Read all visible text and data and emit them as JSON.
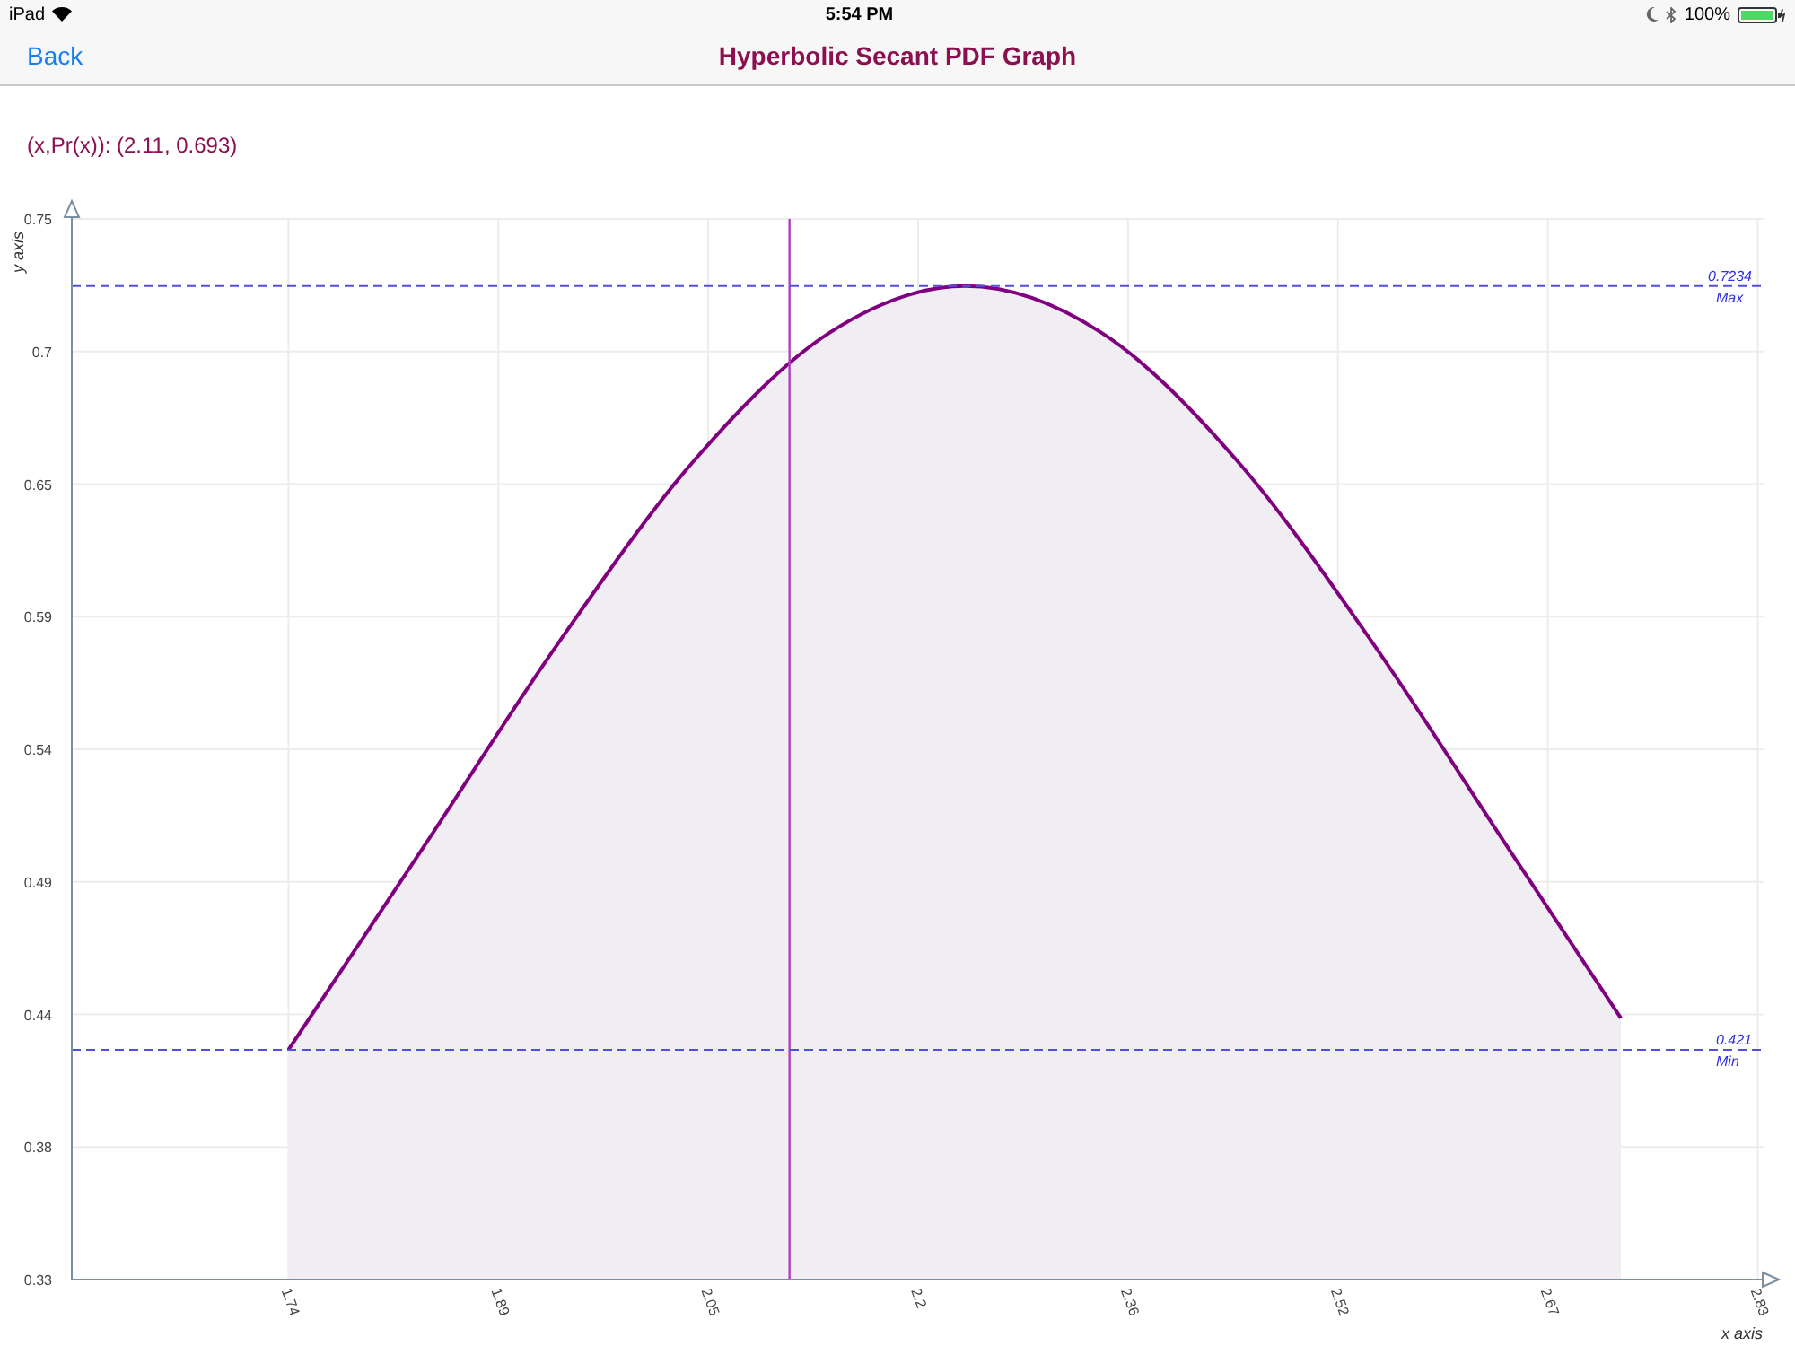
{
  "status_bar": {
    "device": "iPad",
    "time": "5:54 PM",
    "battery": "100%"
  },
  "nav_bar": {
    "back": "Back",
    "title": "Hyperbolic Secant PDF Graph"
  },
  "readout": "(x,Pr(x)): (2.11, 0.693)",
  "chart": {
    "chart_data": {
      "type": "area",
      "xlabel": "x axis",
      "ylabel": "y axis",
      "x": [
        1.74,
        1.84,
        1.94,
        2.04,
        2.14,
        2.24,
        2.34,
        2.44,
        2.54,
        2.64,
        2.724
      ],
      "series": [
        {
          "color": "#800080",
          "values": [
            0.421,
            0.5015,
            0.5826,
            0.6546,
            0.7051,
            0.7234,
            0.7051,
            0.6546,
            0.5826,
            0.5015,
            0.4335
          ]
        }
      ],
      "xlim": [
        1.58,
        2.83
      ],
      "ylim": [
        0.33,
        0.75
      ],
      "xticks": [
        {
          "value": 1.74,
          "label": "1.74"
        },
        {
          "value": 1.895,
          "label": "1.89"
        },
        {
          "value": 2.05,
          "label": "2.05"
        },
        {
          "value": 2.205,
          "label": "2.2"
        },
        {
          "value": 2.36,
          "label": "2.36"
        },
        {
          "value": 2.515,
          "label": "2.52"
        },
        {
          "value": 2.67,
          "label": "2.67"
        },
        {
          "value": 2.825,
          "label": "2.83"
        }
      ],
      "yticks": [
        {
          "value": 0.75,
          "label": "0.75"
        },
        {
          "value": 0.6975,
          "label": "0.7"
        },
        {
          "value": 0.645,
          "label": "0.65"
        },
        {
          "value": 0.5925,
          "label": "0.59"
        },
        {
          "value": 0.54,
          "label": "0.54"
        },
        {
          "value": 0.4875,
          "label": "0.49"
        },
        {
          "value": 0.435,
          "label": "0.44"
        },
        {
          "value": 0.3825,
          "label": "0.38"
        },
        {
          "value": 0.33,
          "label": "0.33"
        }
      ],
      "grid": true,
      "ref_lines": [
        {
          "axis": "x",
          "value": 2.11
        },
        {
          "axis": "y",
          "value": 0.7234,
          "label": "0.7234"
        },
        {
          "axis": "y",
          "value": 0.421,
          "label": "0.421"
        }
      ],
      "annotations": [
        "Max",
        "Min"
      ]
    }
  }
}
